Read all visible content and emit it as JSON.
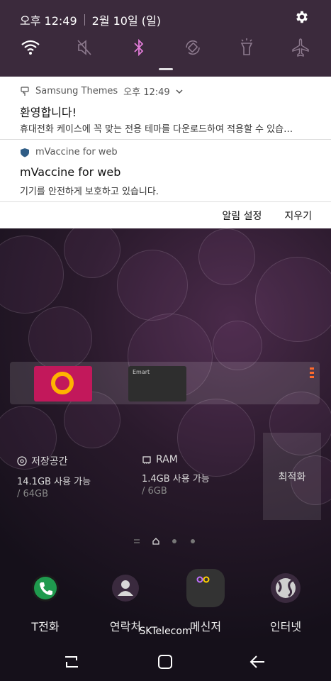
{
  "status_bar": {
    "time": "오후 12:49",
    "date": "2월 10일 (일)"
  },
  "quick_toggles": [
    "wifi-icon",
    "mute-icon",
    "bluetooth-icon",
    "auto-rotate-icon",
    "flashlight-icon",
    "airplane-icon"
  ],
  "notifications": [
    {
      "app": "Samsung Themes",
      "time": "오후 12:49",
      "title": "환영합니다!",
      "text": "휴대전화 케이스에 꼭 맞는 전용 테마를 다운로드하여 적용할 수 있습…"
    },
    {
      "app": "mVaccine for web",
      "title": "mVaccine for web",
      "text": "기기를 안전하게 보호하고 있습니다."
    }
  ],
  "notification_actions": {
    "settings": "알림 설정",
    "clear": "지우기"
  },
  "cards": {
    "card2_label": "Emart"
  },
  "memory": {
    "storage": {
      "label": "저장공간",
      "used": "14.1GB 사용 가능",
      "total": "/ 64GB"
    },
    "ram": {
      "label": "RAM",
      "used": "1.4GB 사용 가능",
      "total": "/ 6GB"
    },
    "optimize": "최적화"
  },
  "dock_apps": [
    {
      "name": "T전화",
      "icon": "phone-icon"
    },
    {
      "name": "연락처",
      "icon": "contacts-icon"
    },
    {
      "name": "메신저",
      "icon": "messenger-icon"
    },
    {
      "name": "인터넷",
      "icon": "internet-icon"
    }
  ],
  "carrier": "SKTelecom",
  "colors": {
    "quick_panel": "#3b2a3c",
    "bluetooth_active": "#e07bd6",
    "card_accent": "#ff6a2c"
  }
}
